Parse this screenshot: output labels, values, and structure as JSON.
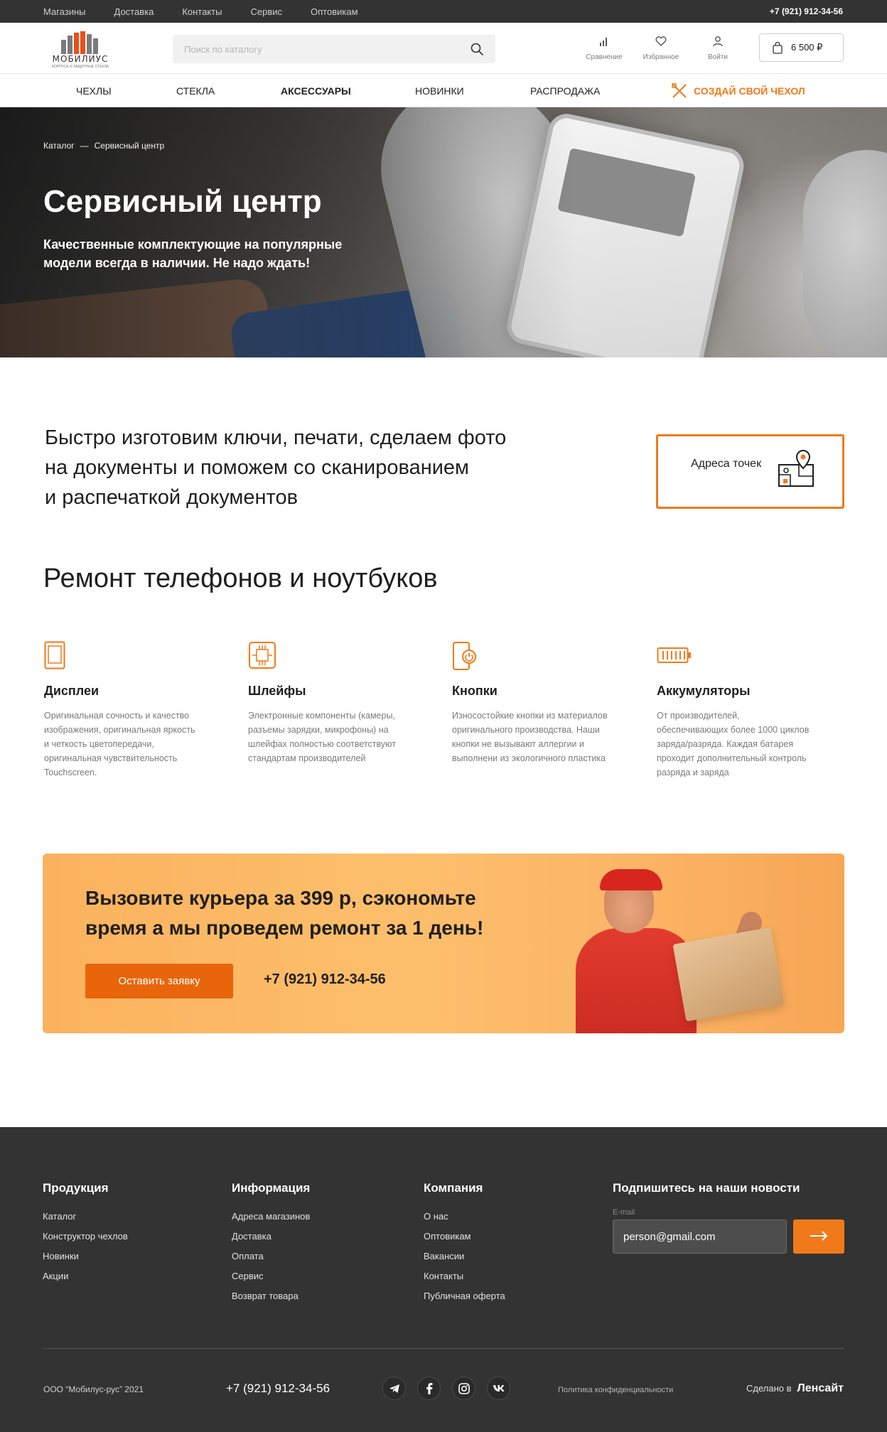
{
  "topbar": {
    "links": [
      "Магазины",
      "Доставка",
      "Контакты",
      "Сервис",
      "Оптовикам"
    ],
    "phone": "+7 (921) 912-34-56"
  },
  "header": {
    "logo_text": "МОБИЛИУС",
    "logo_tagline": "КОРПУСА И ЗАЩИТНЫЕ СТЕКЛА",
    "search_placeholder": "Поиск по каталогу",
    "compare_label": "Сравнение",
    "favorites_label": "Избранное",
    "login_label": "Войти",
    "cart_total": "6 500 ₽"
  },
  "nav": {
    "items": [
      "Чехлы",
      "Стекла",
      "Аксессуары",
      "Новинки",
      "Распродажа"
    ],
    "cta": "Создай свой чехол"
  },
  "hero": {
    "breadcrumb": [
      "Каталог",
      "—",
      "Сервисный центр"
    ],
    "title": "Сервисный центр",
    "subtitle": "Качественные комплектующие на популярные модели всегда в наличии. Не надо ждать!"
  },
  "intro": {
    "text_lines": [
      "Быстро изготовим ключи, печати, сделаем фото",
      "на документы и поможем со сканированием",
      "и распечаткой документов"
    ],
    "address_button": "Адреса точек"
  },
  "repair": {
    "title": "Ремонт телефонов и ноутбуков",
    "features": [
      {
        "icon": "tablet-icon",
        "title": "Дисплеи",
        "text": "Оригинальная сочность и качество изображения, оригинальная яркость и четкость цветопередачи, оригинальная чувствительность Touchscreen."
      },
      {
        "icon": "chip-icon",
        "title": "Шлейфы",
        "text": "Электронные компоненты (камеры, разъемы зарядки, микрофоны) на шлейфах полностью соответствуют стандартам производителей"
      },
      {
        "icon": "phone-power-icon",
        "title": "Кнопки",
        "text": "Износостойкие кнопки из материалов оригинального производства. Наши кнопки не вызывают аллергии и выполнени из экологичного пластика"
      },
      {
        "icon": "battery-icon",
        "title": "Аккумуляторы",
        "text": "От производителей, обеспечивающих более 1000 циклов заряда/разряда. Каждая батарея проходит дополнительный контроль разряда и заряда"
      }
    ]
  },
  "promo": {
    "title": "Вызовите курьера за 399 р, сэкономьте время а мы проведем ремонт за 1 день!",
    "button": "Оставить заявку",
    "phone": "+7 (921) 912-34-56"
  },
  "footer": {
    "columns": [
      {
        "title": "Продукция",
        "links": [
          "Каталог",
          "Конструктор чехлов",
          "Новинки",
          "Акции"
        ]
      },
      {
        "title": "Информация",
        "links": [
          "Адреса магазинов",
          "Доставка",
          "Оплата",
          "Сервис",
          "Возврат товара"
        ]
      },
      {
        "title": "Компания",
        "links": [
          "О нас",
          "Оптовикам",
          "Вакансии",
          "Контакты",
          "Публичная оферта"
        ]
      }
    ],
    "subscribe_title": "Подпишитесь на наши новости",
    "email_label": "E-mail",
    "email_value": "person@gmail.com",
    "copyright": "ООО “Мобилус-рус” 2021",
    "phone": "+7 (921) 912-34-56",
    "privacy": "Политика конфиденциальности",
    "made_in": "Сделано в",
    "made_by": "Ленсайт"
  },
  "colors": {
    "accent": "#f07a1a",
    "dark": "#333333",
    "promo_bg": "#fdbf6c"
  }
}
